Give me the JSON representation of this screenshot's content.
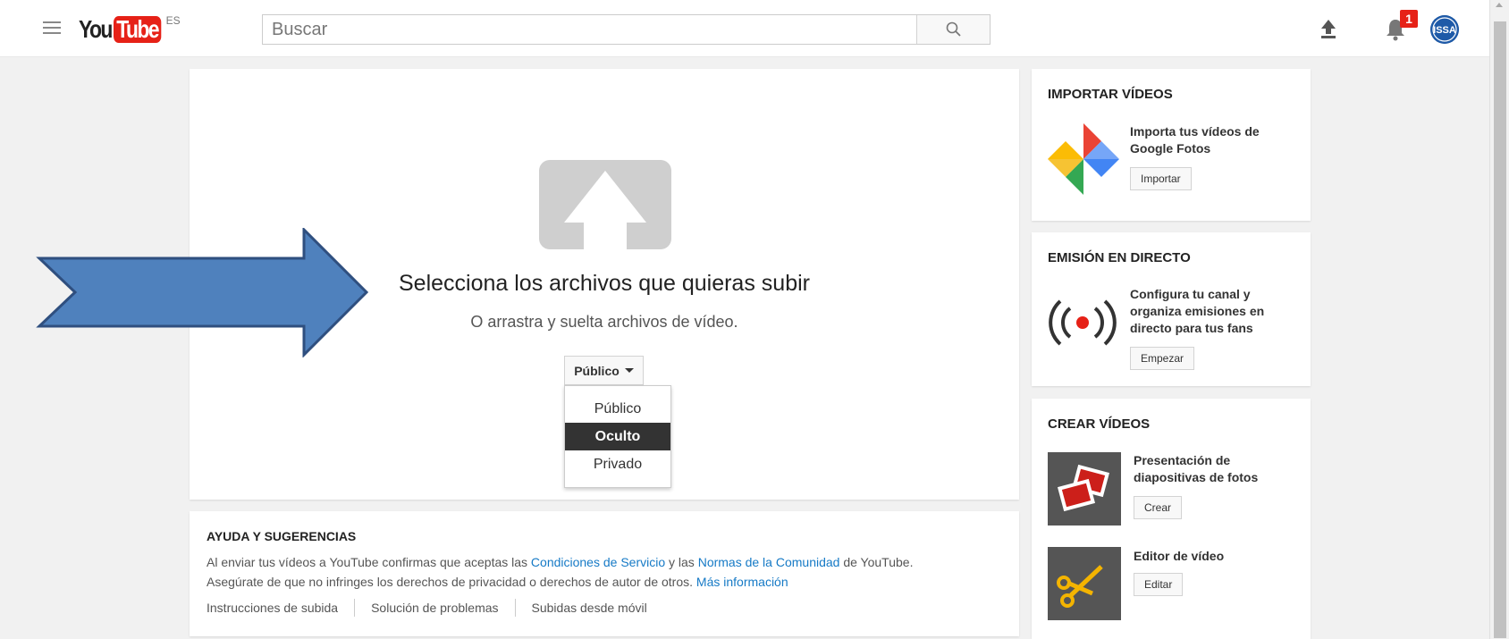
{
  "header": {
    "logo_you": "You",
    "logo_tube": "Tube",
    "logo_locale": "ES",
    "search_placeholder": "Buscar",
    "notification_count": "1",
    "avatar_text": "ISSA"
  },
  "upload": {
    "headline": "Selecciona los archivos que quieras subir",
    "subline": "O arrastra y suelta archivos de vídeo.",
    "privacy_selected": "Público",
    "privacy_options": [
      "Público",
      "Oculto",
      "Privado"
    ],
    "highlighted_option": "Oculto"
  },
  "help": {
    "title": "AYUDA Y SUGERENCIAS",
    "line1_a": "Al enviar tus vídeos a YouTube confirmas que aceptas las ",
    "line1_link1": "Condiciones de Servicio",
    "line1_b": " y las ",
    "line1_link2": "Normas de la Comunidad",
    "line1_c": " de YouTube.",
    "line2_a": "Asegúrate de que no infringes los derechos de privacidad o derechos de autor de otros. ",
    "line2_link": "Más información",
    "links": [
      "Instrucciones de subida",
      "Solución de problemas",
      "Subidas desde móvil"
    ]
  },
  "sidebar": {
    "import": {
      "title": "IMPORTAR VÍDEOS",
      "text": "Importa tus vídeos de Google Fotos",
      "button": "Importar",
      "icon": "google-photos-icon"
    },
    "live": {
      "title": "EMISIÓN EN DIRECTO",
      "text": "Configura tu canal y organiza emisiones en directo para tus fans",
      "button": "Empezar",
      "icon": "live-broadcast-icon"
    },
    "create": {
      "title": "CREAR VÍDEOS",
      "slideshow_text": "Presentación de diapositivas de fotos",
      "slideshow_button": "Crear",
      "editor_text": "Editor de vídeo",
      "editor_button": "Editar"
    }
  },
  "colors": {
    "brand_red": "#e62117",
    "link_blue": "#167ac6",
    "arrow_blue": "#4f81bd"
  }
}
